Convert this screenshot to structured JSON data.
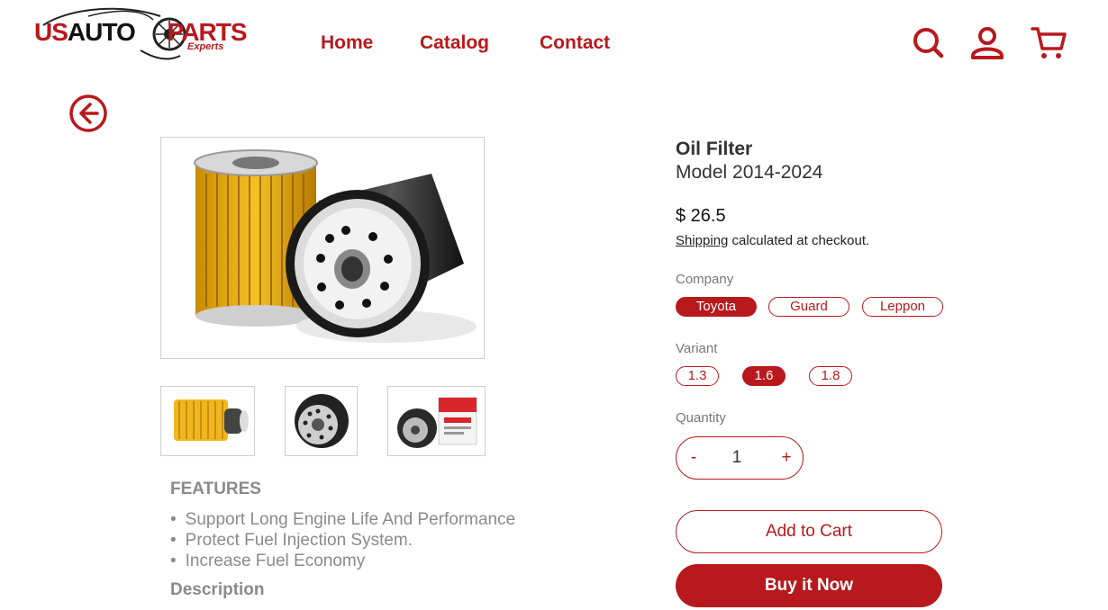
{
  "brand": {
    "logo_main_a": "US",
    "logo_main_b": "AUTO",
    "logo_main_c": "PARTS",
    "logo_sub": "Experts",
    "accent_color": "#b8191c"
  },
  "nav": {
    "home": "Home",
    "catalog": "Catalog",
    "contact": "Contact"
  },
  "header_icons": [
    "search-icon",
    "user-icon",
    "cart-icon"
  ],
  "product": {
    "title": "Oil Filter",
    "model": "Model 2014-2024",
    "price": "$ 26.5",
    "shipping_link": "Shipping",
    "shipping_rest": " calculated at checkout."
  },
  "options": {
    "company_label": "Company",
    "companies": [
      "Toyota",
      "Guard",
      "Leppon"
    ],
    "company_selected": "Toyota",
    "variant_label": "Variant",
    "variants": [
      "1.3",
      "1.6",
      "1.8"
    ],
    "variant_selected": "1.6",
    "quantity_label": "Quantity",
    "qty_minus": "-",
    "qty_value": "1",
    "qty_plus": "+"
  },
  "actions": {
    "add_to_cart": "Add to Cart",
    "buy_now": "Buy it Now"
  },
  "features": {
    "title": "FEATURES",
    "items": [
      "Support Long Engine Life And Performance",
      "Protect Fuel Injection System.",
      "Increase Fuel Economy"
    ],
    "description_title": "Description"
  }
}
